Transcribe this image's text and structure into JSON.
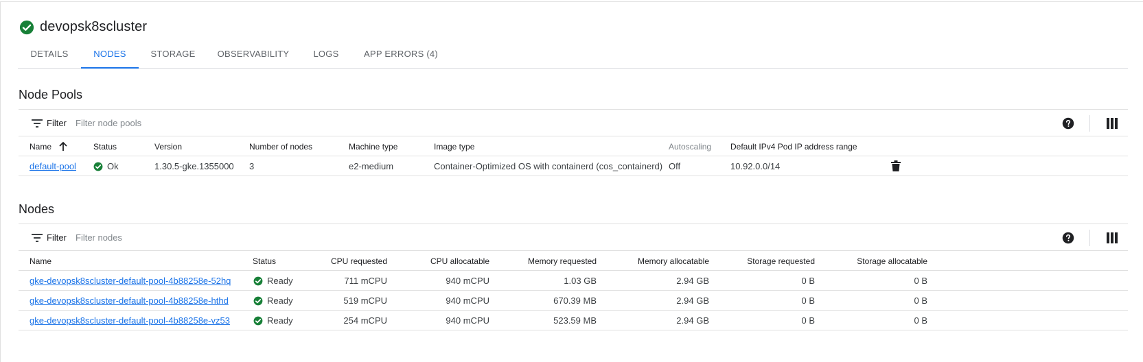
{
  "cluster": {
    "name": "devopsk8scluster"
  },
  "tabs": [
    {
      "label": "DETAILS"
    },
    {
      "label": "NODES"
    },
    {
      "label": "STORAGE"
    },
    {
      "label": "OBSERVABILITY"
    },
    {
      "label": "LOGS"
    },
    {
      "label": "APP ERRORS (4)"
    }
  ],
  "active_tab": "NODES",
  "node_pools": {
    "title": "Node Pools",
    "filter_label": "Filter",
    "filter_placeholder": "Filter node pools",
    "columns": {
      "name": "Name",
      "status": "Status",
      "version": "Version",
      "num_nodes": "Number of nodes",
      "machine_type": "Machine type",
      "image_type": "Image type",
      "autoscaling": "Autoscaling",
      "ip_range": "Default IPv4 Pod IP address range"
    },
    "rows": [
      {
        "name": "default-pool",
        "status": "Ok",
        "version": "1.30.5-gke.1355000",
        "num_nodes": "3",
        "machine_type": "e2-medium",
        "image_type": "Container-Optimized OS with containerd (cos_containerd)",
        "autoscaling": "Off",
        "ip_range": "10.92.0.0/14"
      }
    ]
  },
  "nodes": {
    "title": "Nodes",
    "filter_label": "Filter",
    "filter_placeholder": "Filter nodes",
    "columns": {
      "name": "Name",
      "status": "Status",
      "cpu_requested": "CPU requested",
      "cpu_allocatable": "CPU allocatable",
      "mem_requested": "Memory requested",
      "mem_allocatable": "Memory allocatable",
      "storage_requested": "Storage requested",
      "storage_allocatable": "Storage allocatable"
    },
    "rows": [
      {
        "name": "gke-devopsk8scluster-default-pool-4b88258e-52hq",
        "status": "Ready",
        "cpu_requested": "711 mCPU",
        "cpu_allocatable": "940 mCPU",
        "mem_requested": "1.03 GB",
        "mem_allocatable": "2.94 GB",
        "storage_requested": "0 B",
        "storage_allocatable": "0 B"
      },
      {
        "name": "gke-devopsk8scluster-default-pool-4b88258e-hthd",
        "status": "Ready",
        "cpu_requested": "519 mCPU",
        "cpu_allocatable": "940 mCPU",
        "mem_requested": "670.39 MB",
        "mem_allocatable": "2.94 GB",
        "storage_requested": "0 B",
        "storage_allocatable": "0 B"
      },
      {
        "name": "gke-devopsk8scluster-default-pool-4b88258e-vz53",
        "status": "Ready",
        "cpu_requested": "254 mCPU",
        "cpu_allocatable": "940 mCPU",
        "mem_requested": "523.59 MB",
        "mem_allocatable": "2.94 GB",
        "storage_requested": "0 B",
        "storage_allocatable": "0 B"
      }
    ]
  },
  "icons": {
    "status_ok": "check-circle-icon",
    "filter": "filter-icon",
    "help": "help-icon",
    "columns": "column-display-icon",
    "sort": "sort-arrow-up-icon",
    "delete": "trash-icon"
  },
  "colors": {
    "accent": "#1a73e8",
    "success": "#188038",
    "text": "#202124",
    "muted": "#80868b"
  }
}
